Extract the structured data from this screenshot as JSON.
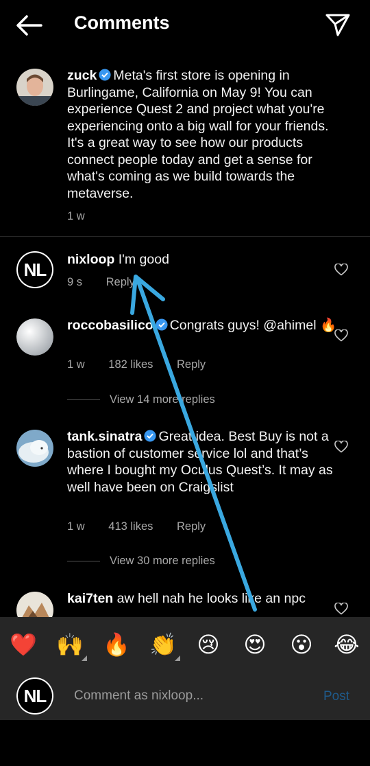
{
  "header": {
    "title": "Comments"
  },
  "post": {
    "username": "zuck",
    "verified": true,
    "caption": "Meta's first store is opening in Burlingame, California on May 9! You can experience Quest 2 and project what you're experiencing onto a big wall for your friends. It's a great way to see how our products connect people today and get a sense for what's coming as we build towards the metaverse.",
    "time": "1 w"
  },
  "comments": [
    {
      "username": "nixloop",
      "avatar_text": "NL",
      "text": "I'm good",
      "time": "9 s",
      "reply_label": "Reply"
    },
    {
      "username": "roccobasilico",
      "verified": true,
      "text": "Congrats guys! @ahimel 🔥",
      "time": "1 w",
      "likes": "182 likes",
      "reply_label": "Reply",
      "view_more": "View 14 more replies"
    },
    {
      "username": "tank.sinatra",
      "verified": true,
      "text": "Great idea. Best Buy is not a bastion of customer service lol and that’s where I bought my Oculus Quest’s. It may as well have been on Craigslist",
      "time": "1 w",
      "likes": "413 likes",
      "reply_label": "Reply",
      "view_more": "View 30 more replies"
    },
    {
      "username": "kai7ten",
      "text": "aw hell nah he looks like an npc"
    }
  ],
  "emoji_bar": [
    "❤️",
    "🙌",
    "🔥",
    "👏",
    "😢",
    "😍",
    "😮",
    "😂"
  ],
  "composer": {
    "avatar_text": "NL",
    "placeholder": "Comment as nixloop...",
    "post_label": "Post"
  },
  "colors": {
    "background": "#000000",
    "secondary_text": "#a8a8a8",
    "bar_background": "#262626",
    "verified_blue": "#3897f0",
    "annotation_arrow": "#3aa8e0",
    "post_disabled": "#1f5a8a"
  }
}
